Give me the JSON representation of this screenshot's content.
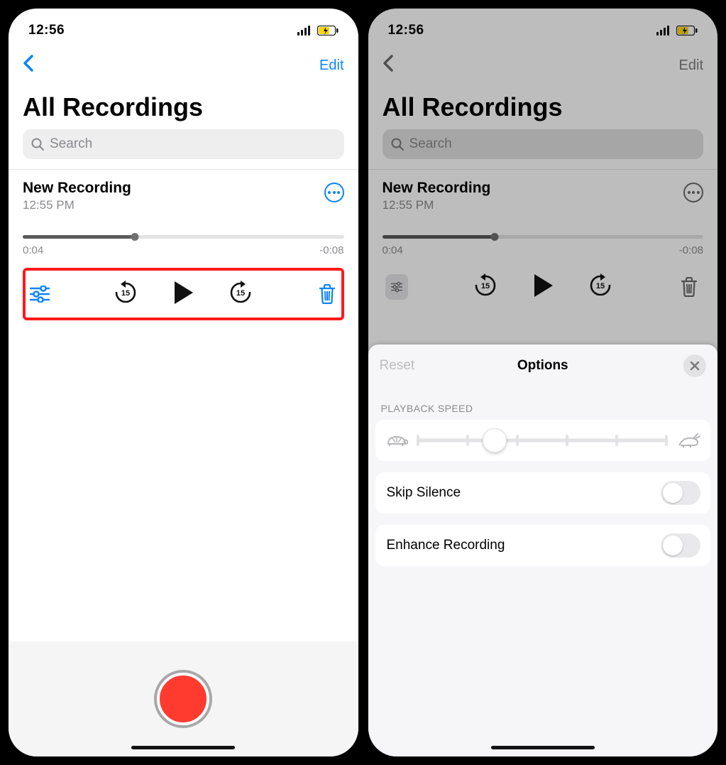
{
  "status": {
    "time": "12:56"
  },
  "nav": {
    "edit_label": "Edit"
  },
  "header": {
    "title": "All Recordings"
  },
  "search": {
    "placeholder": "Search"
  },
  "recording": {
    "title": "New Recording",
    "subtitle": "12:55 PM",
    "elapsed": "0:04",
    "remaining": "-0:08",
    "progress_pct": 35
  },
  "controls": {
    "skip_back_sec": "15",
    "skip_fwd_sec": "15"
  },
  "options": {
    "reset_label": "Reset",
    "title": "Options",
    "speed_section_label": "PLAYBACK SPEED",
    "skip_silence_label": "Skip Silence",
    "skip_silence_on": false,
    "enhance_label": "Enhance Recording",
    "enhance_on": false,
    "speed_value_pct": 31
  }
}
